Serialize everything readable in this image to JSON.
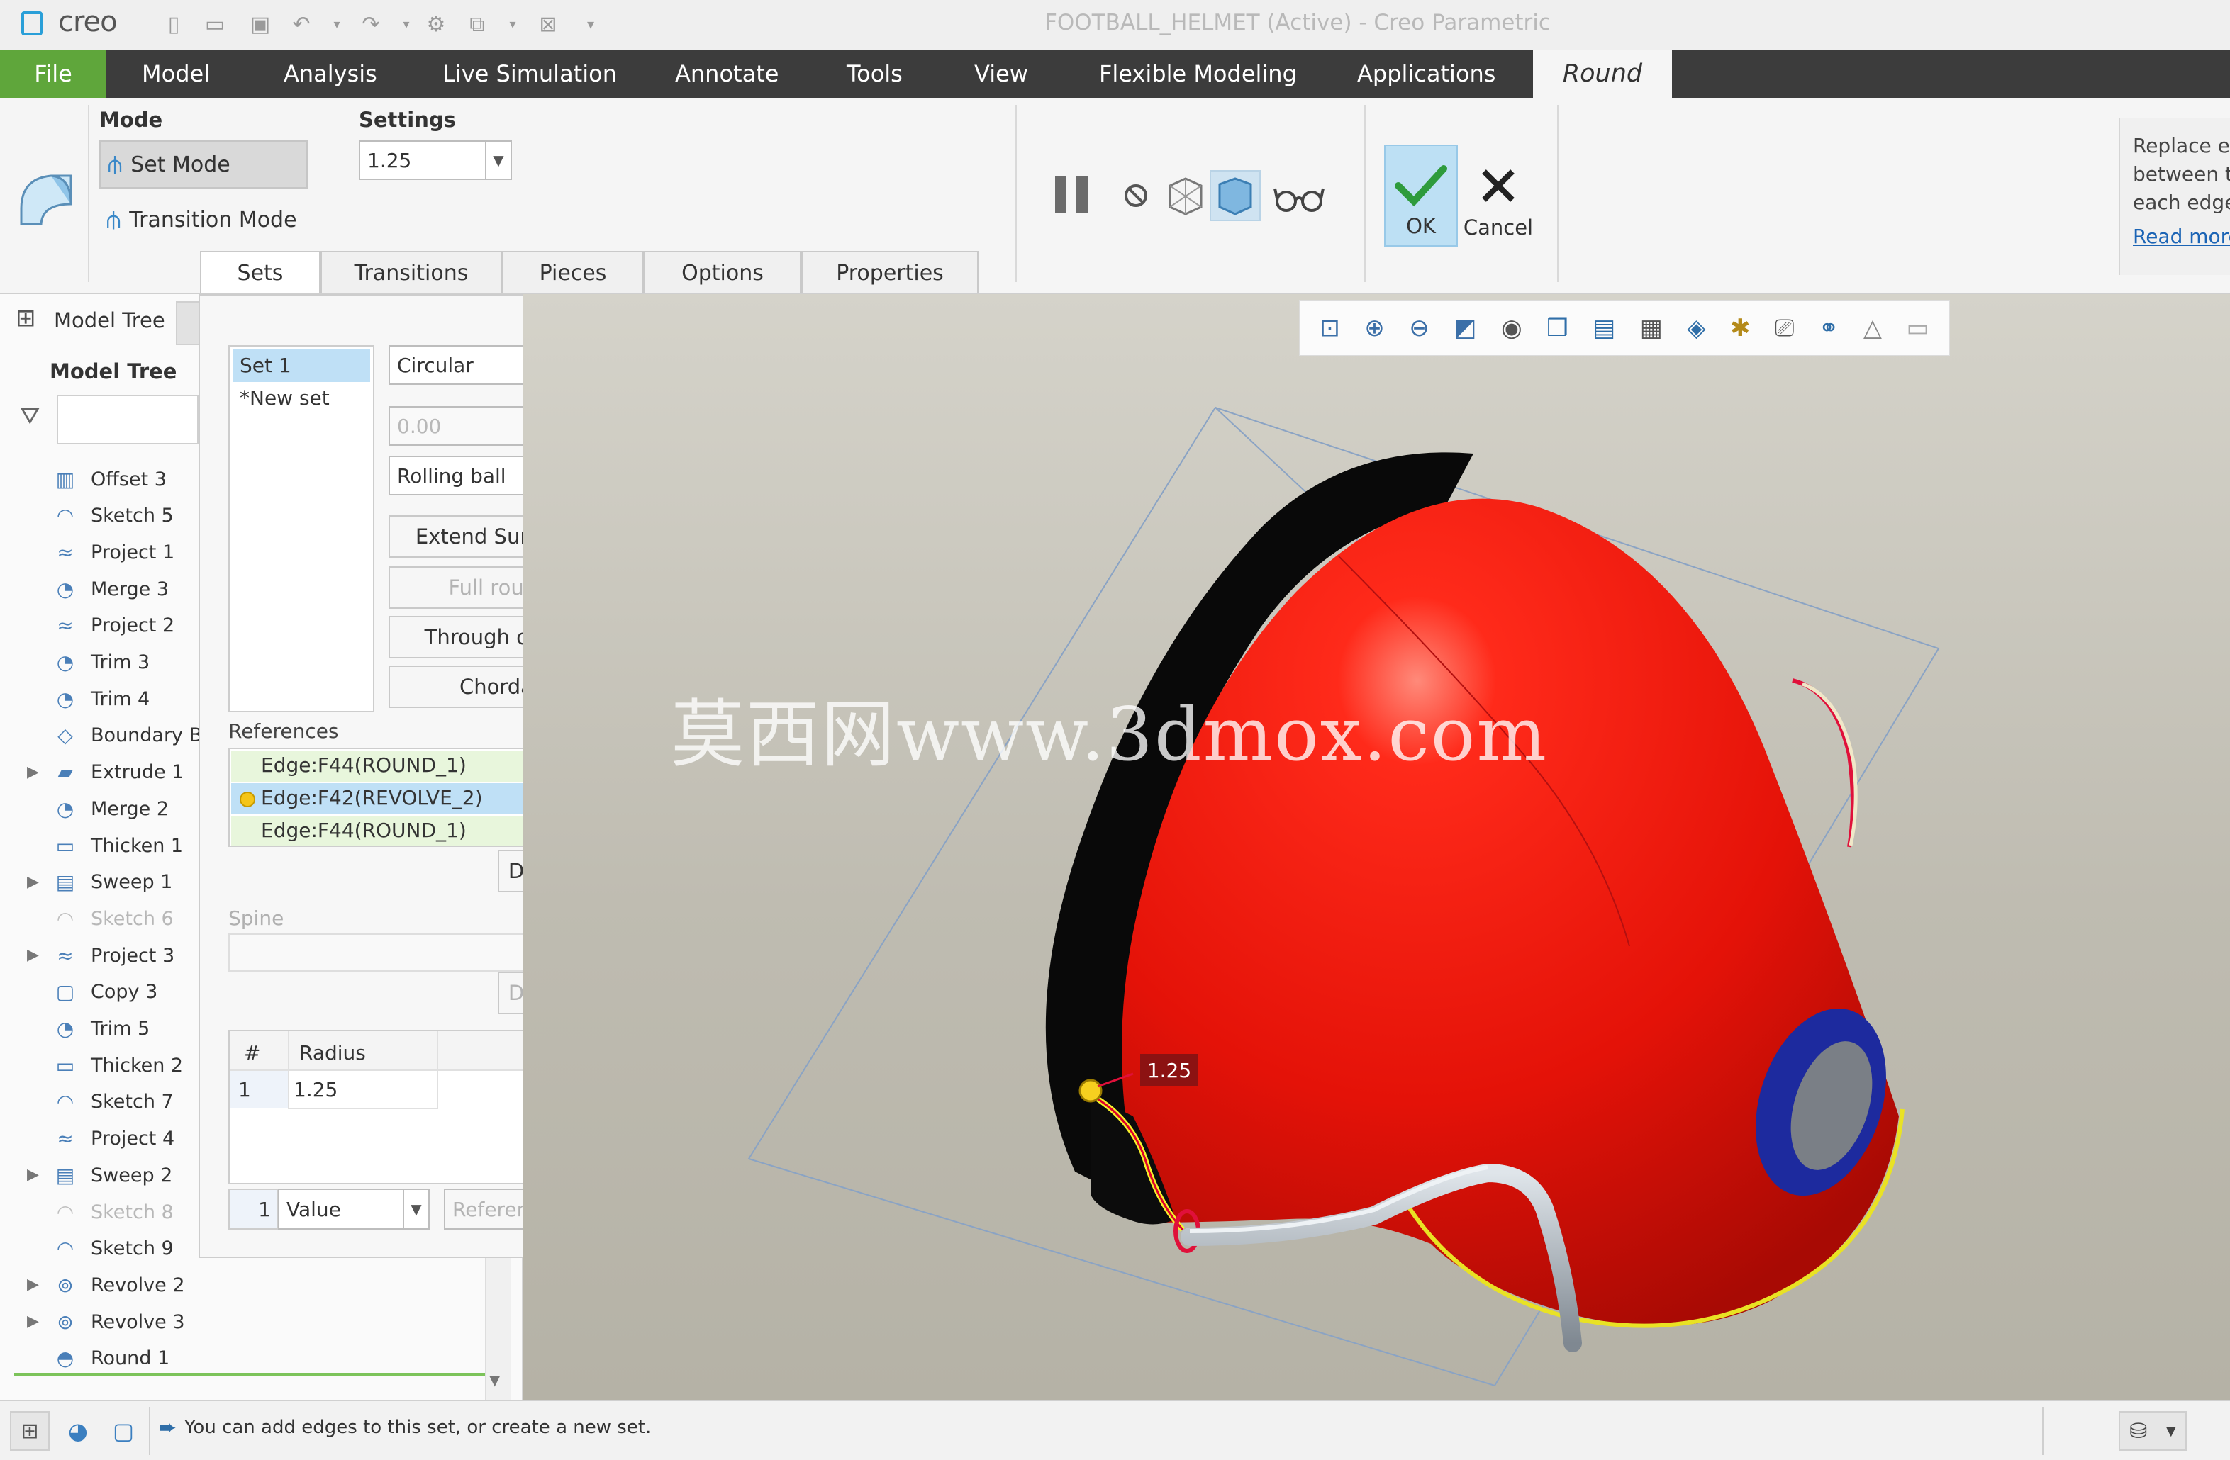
{
  "app": {
    "logo_text": "creo",
    "window_title": "FOOTBALL_HELMET (Active) - Creo Parametric"
  },
  "menu_tabs": [
    "File",
    "Model",
    "Analysis",
    "Live Simulation",
    "Annotate",
    "Tools",
    "View",
    "Flexible Modeling",
    "Applications",
    "Round"
  ],
  "mode": {
    "group_title": "Mode",
    "set_mode": "Set Mode",
    "transition_mode": "Transition Mode"
  },
  "settings": {
    "group_title": "Settings",
    "radius_value": "1.25"
  },
  "ok_cancel": {
    "ok": "OK",
    "cancel": "Cancel"
  },
  "help": {
    "line1": "Replace ec",
    "line2": "between th",
    "line3": "each edge",
    "link": "Read more"
  },
  "sub_tabs": [
    "Sets",
    "Transitions",
    "Pieces",
    "Options",
    "Properties"
  ],
  "tree": {
    "tab_label": "Model Tree",
    "header": "Model Tree",
    "items": [
      {
        "label": "Offset 3"
      },
      {
        "label": "Sketch 5"
      },
      {
        "label": "Project 1"
      },
      {
        "label": "Merge 3"
      },
      {
        "label": "Project 2"
      },
      {
        "label": "Trim 3"
      },
      {
        "label": "Trim 4"
      },
      {
        "label": "Boundary Ble"
      },
      {
        "label": "Extrude 1"
      },
      {
        "label": "Merge 2"
      },
      {
        "label": "Thicken 1"
      },
      {
        "label": "Sweep 1"
      },
      {
        "label": "Sketch 6"
      },
      {
        "label": "Project 3"
      },
      {
        "label": "Copy 3"
      },
      {
        "label": "Trim 5"
      },
      {
        "label": "Thicken 2"
      },
      {
        "label": "Sketch 7"
      },
      {
        "label": "Project 4"
      },
      {
        "label": "Sweep 2"
      },
      {
        "label": "Sketch 8"
      },
      {
        "label": "Sketch 9"
      },
      {
        "label": "Revolve 2"
      },
      {
        "label": "Revolve 3"
      },
      {
        "label": "Round 1"
      }
    ]
  },
  "sets_panel": {
    "set_items": [
      "Set 1",
      "*New set"
    ],
    "shape_type": "Circular",
    "distance": "0.00",
    "method": "Rolling ball",
    "btn_extend": "Extend Surfaces",
    "btn_full_round": "Full round",
    "btn_through_curve": "Through curve",
    "btn_chordal": "Chordal",
    "references_label": "References",
    "references": [
      "Edge:F44(ROUND_1)",
      "Edge:F42(REVOLVE_2)",
      "Edge:F44(ROUND_1)"
    ],
    "details_btn": "Details...",
    "spine_label": "Spine",
    "spine_details_btn": "Details...",
    "table_header_num": "#",
    "table_header_radius": "Radius",
    "table_row_num": "1",
    "table_row_radius": "1.25",
    "bottom_num": "1",
    "bottom_value": "Value",
    "bottom_reference": "Reference"
  },
  "viewport": {
    "watermark": "莫西网www.3dmox.com",
    "dim_label": "1.25",
    "helmet_color": "#e8140f"
  },
  "status": {
    "message": "You can add edges to this set, or create a new set."
  }
}
